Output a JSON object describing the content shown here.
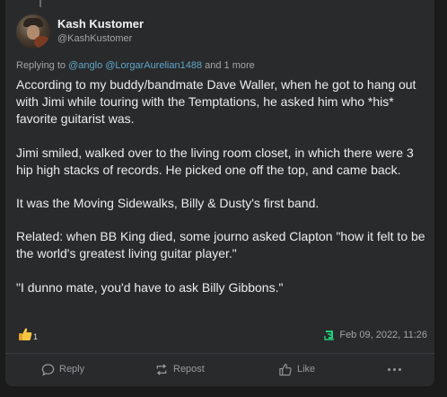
{
  "post": {
    "author": {
      "display_name": "Kash Kustomer",
      "handle": "@KashKustomer"
    },
    "replying": {
      "prefix": "Replying to",
      "mentions": [
        "@anglo",
        "@LorgarAurelian1488"
      ],
      "suffix": "and 1 more"
    },
    "paragraphs": [
      "According to my buddy/bandmate Dave Waller, when he got to hang out with Jimi while touring with the Temptations, he asked him who *his* favorite guitarist was.",
      "Jimi smiled, walked over to the living room closet, in which there were 3 hip high stacks of records. He picked one off the top, and came back.",
      "It was the Moving Sidewalks, Billy & Dusty's first band.",
      "Related: when BB King died, some journo asked Clapton \"how it felt to be the world's greatest living guitar player.\"",
      "\"I dunno mate, you'd have to ask Billy Gibbons.\""
    ],
    "reaction": {
      "icon": "thumbs-up-emoji",
      "count": "1"
    },
    "timestamp": "Feb 09, 2022, 11:26",
    "timestamp_icon": "gab-logo-icon"
  },
  "actions": {
    "reply": "Reply",
    "repost": "Repost",
    "like": "Like",
    "more_icon": "ellipsis-icon"
  },
  "colors": {
    "background": "#1b1b1c",
    "card": "#292a2c",
    "mention": "#5fa8c7",
    "brand_green": "#21cf7a",
    "reaction_yellow": "#f5c542"
  }
}
